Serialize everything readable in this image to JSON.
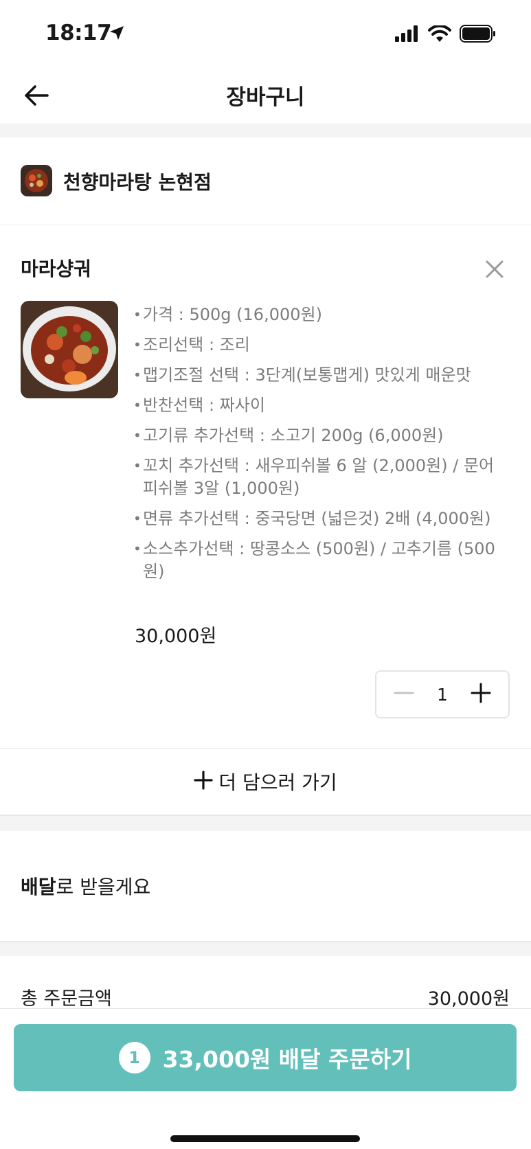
{
  "status_bar": {
    "time": "18:17"
  },
  "nav": {
    "title": "장바구니"
  },
  "store": {
    "name": "천향마라탕 논현점"
  },
  "cart_item": {
    "name": "마라샹궈",
    "options": [
      "가격 : 500g (16,000원)",
      "조리선택 : 조리",
      "맵기조절 선택 : 3단계(보통맵게) 맛있게 매운맛",
      "반찬선택 : 짜사이",
      "고기류 추가선택 : 소고기 200g (6,000원)",
      "꼬치 추가선택 : 새우피쉬볼 6 알 (2,000원) / 문어피쉬볼 3알 (1,000원)",
      "면류 추가선택 : 중국당면 (넓은것) 2배 (4,000원)",
      "소스추가선택 : 땅콩소스 (500원) / 고추기름 (500원)"
    ],
    "price": "30,000원",
    "quantity": "1"
  },
  "add_more": {
    "label": "더 담으러 가기"
  },
  "delivery": {
    "emphasis": "배달",
    "rest": "로 받을게요"
  },
  "summary": {
    "total_label": "총 주문금액",
    "total_value": "30,000원"
  },
  "order_button": {
    "count": "1",
    "label": "33,000원 배달 주문하기"
  },
  "colors": {
    "accent": "#63bfba",
    "text_muted": "#7c7c7c",
    "band": "#f4f4f4"
  }
}
